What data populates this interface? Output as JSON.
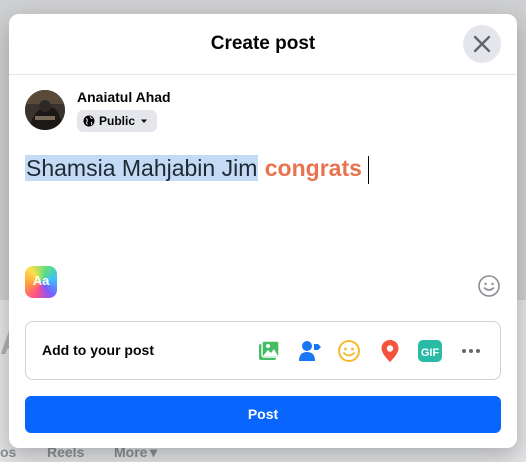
{
  "background": {
    "partial_letter": "A",
    "tabs": [
      "os",
      "Reels",
      "More"
    ]
  },
  "dialog": {
    "title": "Create post",
    "close_icon": "close-icon"
  },
  "user": {
    "name": "Anaiatul Ahad",
    "privacy_label": "Public",
    "privacy_icon": "globe-icon"
  },
  "composer": {
    "mention": "Shamsia Mahjabin Jim",
    "text": "congrats",
    "mention_highlight_color": "#c5daf5",
    "text_color": "#e9734f"
  },
  "tools": {
    "background_button_label": "Aa",
    "emoji_icon": "smiley-icon"
  },
  "add_to_post": {
    "label": "Add to your post",
    "items": [
      "photo-video-icon",
      "tag-people-icon",
      "feeling-icon",
      "location-icon",
      "gif-icon",
      "more-icon"
    ]
  },
  "post_button": {
    "label": "Post",
    "color": "#0866ff"
  }
}
